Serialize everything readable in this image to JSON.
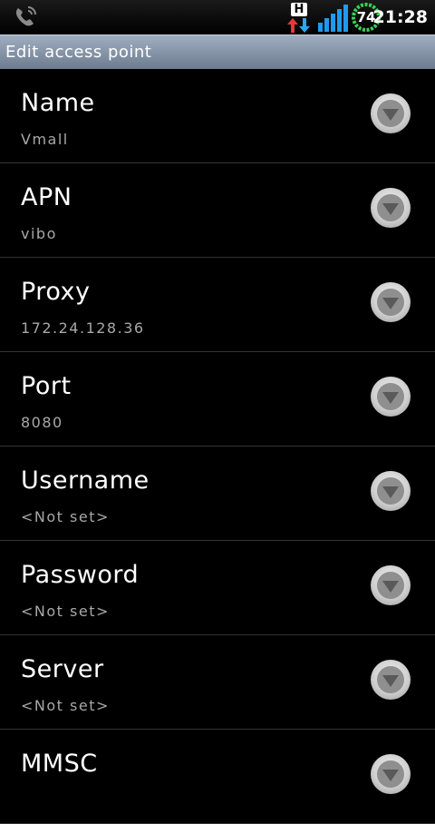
{
  "status_bar": {
    "network_type": "H",
    "battery_level": "74",
    "time": "21:28",
    "colors": {
      "network_up": "#e53935",
      "network_down": "#29a8f0",
      "signal": "#1e9bf0",
      "battery_ring": "#39d353"
    }
  },
  "title_bar": {
    "title": "Edit access point"
  },
  "apn_fields": [
    {
      "label": "Name",
      "value": "Vmall"
    },
    {
      "label": "APN",
      "value": "vibo"
    },
    {
      "label": "Proxy",
      "value": "172.24.128.36"
    },
    {
      "label": "Port",
      "value": "8080"
    },
    {
      "label": "Username",
      "value": "<Not set>"
    },
    {
      "label": "Password",
      "value": "<Not set>"
    },
    {
      "label": "Server",
      "value": "<Not set>"
    },
    {
      "label": "MMSC",
      "value": ""
    }
  ],
  "icons": {
    "call": "phone-icon",
    "network": "network-activity-icon",
    "signal": "signal-strength-icon",
    "battery": "battery-icon",
    "expand": "chevron-down-icon"
  }
}
